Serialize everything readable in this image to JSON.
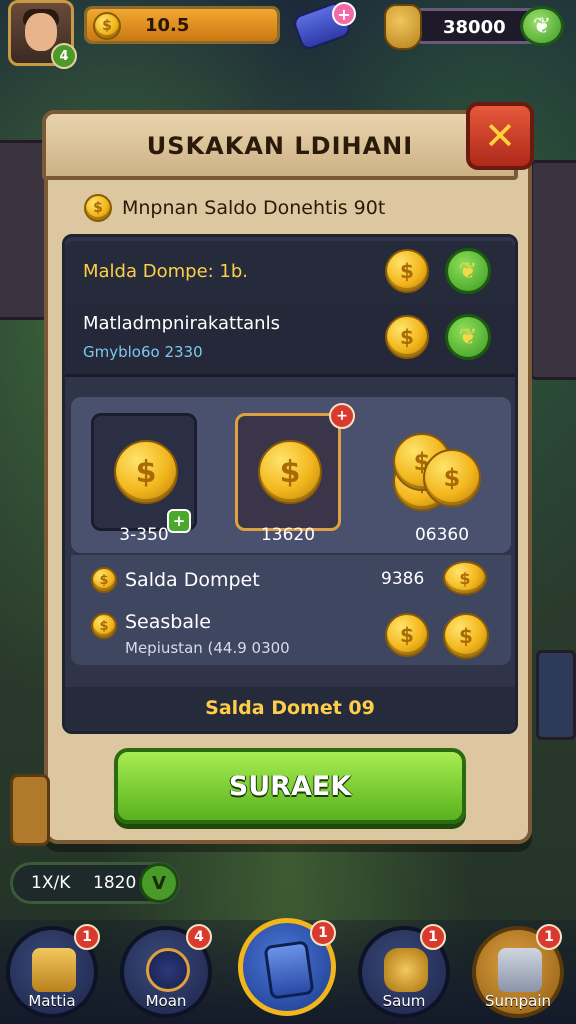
{
  "hud": {
    "gold_value": "10.5",
    "gold_fill": 1.0,
    "gem_plus": "+",
    "cash_value": "38000",
    "level_badge": "4",
    "cash_icon": "money-wings-icon"
  },
  "modal": {
    "title": "USKAKAN LDIHANI",
    "close": "✕",
    "subtitle": "Mnpnan Saldo Donehtis 90t",
    "row1_label": "Malda Dompe: 1b.",
    "row2_label": "Matladmpnirakattanls",
    "row2_sub": "Gmyblo6o 2330",
    "options": [
      {
        "value": "3-350",
        "badge": "+"
      },
      {
        "value": "13620",
        "badge": "+"
      },
      {
        "value": "06360"
      }
    ],
    "info1_label": "Salda Dompet",
    "info1_value": "9386",
    "info2_label": "Seasbale",
    "info2_sub": "Mepiustan (44.9 0300",
    "footer": "Salda Domet 09",
    "confirm": "SURAEK"
  },
  "side": {
    "pill_a": "1X/K",
    "pill_b": "1820",
    "pill_v": "V"
  },
  "nav": {
    "items": [
      {
        "label": "Mattia",
        "badge": "1",
        "icon": "scroll-icon"
      },
      {
        "label": "Moan",
        "badge": "4",
        "icon": "compass-icon"
      },
      {
        "label": "",
        "badge": "1",
        "icon": "wallet-phone-icon"
      },
      {
        "label": "Saum",
        "badge": "1",
        "icon": "gold-bag-icon"
      },
      {
        "label": "Sumpain",
        "badge": "1",
        "icon": "shop-icon"
      }
    ]
  },
  "colors": {
    "panel": "#dcc7a0",
    "accent_gold": "#ffce48",
    "confirm_green": "#6cc22a",
    "close_red": "#c83a22"
  }
}
